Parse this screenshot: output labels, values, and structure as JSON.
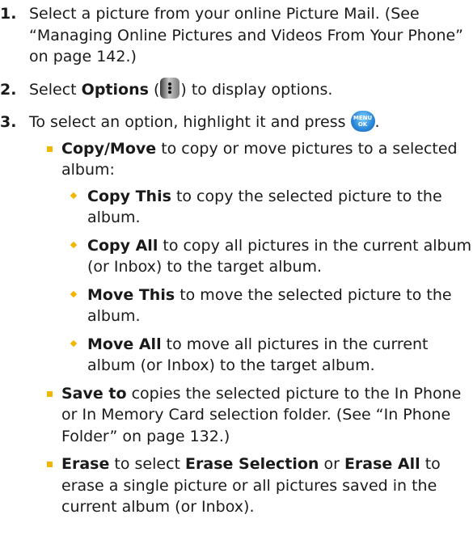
{
  "steps": [
    {
      "num": "1.",
      "text": "Select a picture from your online Picture Mail. (See “Managing Online Pictures and Videos From Your Phone” on page 142.)"
    },
    {
      "num": "2.",
      "pre": "Select",
      "bold": "Options",
      "open_paren": " (",
      "close": ") to display options."
    },
    {
      "num": "3.",
      "text": "To select an option, highlight it and press"
    }
  ],
  "icons": {
    "options_key": "options-softkey-icon",
    "menu_ok_key": "menu-ok-key-icon",
    "menu_ok_label_top": "MENU",
    "menu_ok_label_bottom": "OK"
  },
  "options": [
    {
      "bold": "Copy/Move",
      "text": " to copy or move pictures to a selected album:",
      "sub": [
        {
          "bold": "Copy This",
          "text": " to copy the selected picture to the album."
        },
        {
          "bold": "Copy All",
          "text": " to copy all pictures in the current album (or Inbox) to the target album."
        },
        {
          "bold": "Move This",
          "text": " to move the selected picture to the album."
        },
        {
          "bold": "Move All",
          "text": " to move all pictures in the current album (or Inbox) to the target album."
        }
      ]
    },
    {
      "bold": "Save to",
      "text": " copies the selected picture to the In Phone or In Memory Card selection folder. (See “In Phone Folder” on page 132.)"
    },
    {
      "bold": "Erase",
      "text_a": " to select ",
      "bold_b": "Erase Selection",
      "text_b": " or ",
      "bold_c": "Erase All",
      "text_c": " to erase a single picture or all pictures saved in the current album (or Inbox)."
    }
  ],
  "colors": {
    "bullet": "#f2b600",
    "text": "#1a1a1a"
  }
}
